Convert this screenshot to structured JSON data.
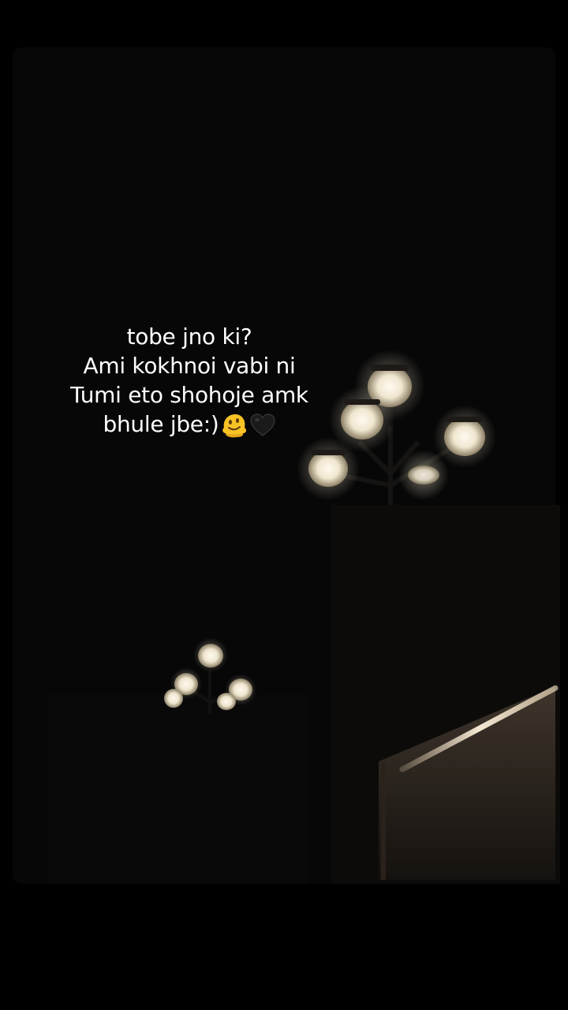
{
  "caption": {
    "lines": [
      "tobe jno ki?",
      "Ami kokhnoi vabi ni",
      "Tumi eto shohoje amk",
      "bhule jbe:)"
    ],
    "emojis": [
      "melting-face-emoji",
      "black-heart-emoji"
    ]
  },
  "colors": {
    "background": "#000000",
    "lamp_glow": "#fff6e2",
    "caption_text": "#ffffff"
  }
}
